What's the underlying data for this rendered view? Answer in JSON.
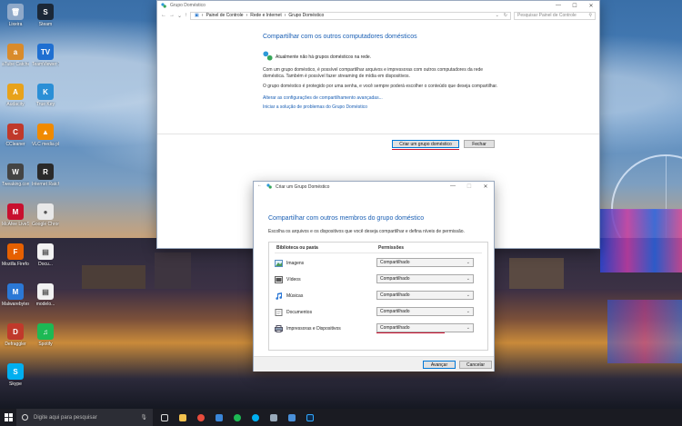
{
  "desktop_icons": [
    {
      "name": "lixeira-icon",
      "label": "Lixeira",
      "color": "#8fa9c9",
      "glyph": "🗑"
    },
    {
      "name": "steam-icon",
      "label": "Steam",
      "color": "#1b2838",
      "glyph": "S"
    },
    {
      "name": "atube-catcher-icon",
      "label": "aTube Catcher",
      "color": "#d98b2b",
      "glyph": "a"
    },
    {
      "name": "teamviewer-icon",
      "label": "TeamViewer 11",
      "color": "#1f6fd1",
      "glyph": "TV"
    },
    {
      "name": "audacity-icon",
      "label": "Audacity",
      "color": "#e8a21a",
      "glyph": "A"
    },
    {
      "name": "true-key-icon",
      "label": "True Key",
      "color": "#2b8fd6",
      "glyph": "K"
    },
    {
      "name": "ccleaner-icon",
      "label": "CCleaner",
      "color": "#c0392b",
      "glyph": "C"
    },
    {
      "name": "vlc-icon",
      "label": "VLC media player",
      "color": "#f08a00",
      "glyph": "▲"
    },
    {
      "name": "tweaking-icon",
      "label": "Tweaking.com",
      "color": "#444",
      "glyph": "W"
    },
    {
      "name": "internet-ratchet-icon",
      "label": "Internet Ratchet",
      "color": "#2a2a2a",
      "glyph": "R"
    },
    {
      "name": "mcafee-icon",
      "label": "McAfee LiveSafe",
      "color": "#c8102e",
      "glyph": "M"
    },
    {
      "name": "chrome-icon",
      "label": "Google Chrome",
      "color": "#e8e8e8",
      "glyph": "●"
    },
    {
      "name": "firefox-icon",
      "label": "Mozilla Firefox",
      "color": "#e66000",
      "glyph": "F"
    },
    {
      "name": "document-icon-1",
      "label": "Docu...",
      "color": "#f2f2f2",
      "glyph": "▤"
    },
    {
      "name": "malwarebytes-icon",
      "label": "Malwarebytes",
      "color": "#2b78d6",
      "glyph": "M"
    },
    {
      "name": "modelo-icon",
      "label": "modelo...",
      "color": "#f2f2f2",
      "glyph": "▤"
    },
    {
      "name": "defraggler-icon",
      "label": "Defraggler",
      "color": "#c0392b",
      "glyph": "D"
    },
    {
      "name": "spotify-icon",
      "label": "Spotify",
      "color": "#1db954",
      "glyph": "♫"
    },
    {
      "name": "skype-icon",
      "label": "Skype",
      "color": "#00aff0",
      "glyph": "S"
    }
  ],
  "homegroup_window": {
    "title": "Grupo Doméstico",
    "breadcrumb": [
      "Painel de Controle",
      "Rede e Internet",
      "Grupo Doméstico"
    ],
    "search_placeholder": "Pesquisar Painel de Controle",
    "heading": "Compartilhar com os outros computadores domésticos",
    "status": "Atualmente não há grupos domésticos na rede.",
    "para1": "Com um grupo doméstico, é possível compartilhar arquivos e impressoras com outros computadores da rede doméstica. Também é possível fazer streaming de mídia em dispositivos.",
    "para2": "O grupo doméstico é protegido por uma senha, e você sempre poderá escolher o conteúdo que deseja compartilhar.",
    "link1": "Alterar as configurações de compartilhamento avançadas...",
    "link2": "Iniciar a solução de problemas do Grupo Doméstico",
    "create_button": "Criar um grupo doméstico",
    "close_button": "Fechar"
  },
  "wizard": {
    "title": "Criar um Grupo Doméstico",
    "heading": "Compartilhar com outros membros do grupo doméstico",
    "subtitle": "Escolha os arquivos e os dispositivos que você deseja compartilhar e defina níveis de permissão.",
    "col_library": "Biblioteca ou pasta",
    "col_permissions": "Permissões",
    "rows": [
      {
        "name": "Imagens",
        "permission": "Compartilhado",
        "icon": "pictures-icon"
      },
      {
        "name": "Vídeos",
        "permission": "Compartilhado",
        "icon": "videos-icon"
      },
      {
        "name": "Músicas",
        "permission": "Compartilhado",
        "icon": "music-icon"
      },
      {
        "name": "Documentos",
        "permission": "Compartilhado",
        "icon": "documents-icon"
      },
      {
        "name": "Impressoras e Dispositivos",
        "permission": "Compartilhado",
        "icon": "printer-icon"
      }
    ],
    "next_button": "Avançar",
    "cancel_button": "Cancelar"
  },
  "taskbar": {
    "search_placeholder": "Digite aqui para pesquisar"
  },
  "colors": {
    "accent": "#1a5fb4",
    "highlight_underline": "#c8102e",
    "taskbar": "#1a1b22"
  }
}
